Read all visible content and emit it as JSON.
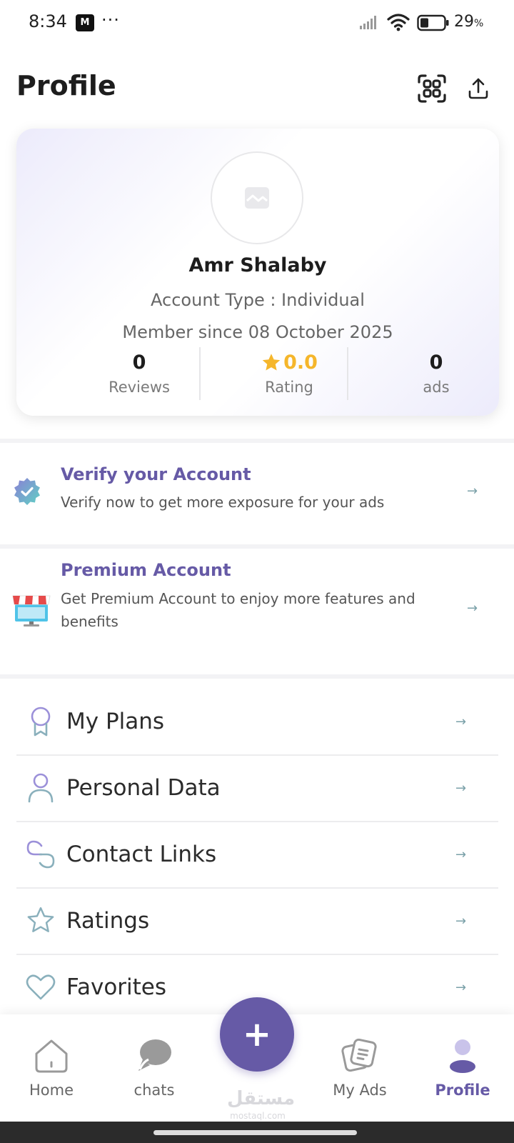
{
  "status_bar": {
    "time": "8:34",
    "app_badge": "M",
    "dots": "···",
    "battery_percent": "29",
    "percent_sign": "%"
  },
  "header": {
    "title": "Profile",
    "icons": [
      "qr-scan-icon",
      "share-icon"
    ]
  },
  "profile": {
    "name": "Amr Shalaby",
    "account_type": "Account Type : Individual",
    "member_since": "Member since 08 October 2025",
    "stats": [
      {
        "value": "0",
        "label": "Reviews"
      },
      {
        "value": "0.0",
        "label": "Rating"
      },
      {
        "value": "0",
        "label": "ads"
      }
    ]
  },
  "promos": [
    {
      "title": "Verify your Account",
      "description": "Verify now to get more exposure for your ads",
      "icon": "verified-badge-icon"
    },
    {
      "title": "Premium Account",
      "description": "Get Premium Account to enjoy more features and benefits",
      "icon": "store-icon"
    }
  ],
  "menu": [
    {
      "label": "My Plans",
      "icon": "award-icon"
    },
    {
      "label": "Personal Data",
      "icon": "user-icon"
    },
    {
      "label": "Contact Links",
      "icon": "link-icon"
    },
    {
      "label": "Ratings",
      "icon": "star-icon"
    },
    {
      "label": "Favorites",
      "icon": "heart-icon"
    }
  ],
  "arrow_glyph": "→",
  "bottom_nav": {
    "items": [
      {
        "label": "Home",
        "icon": "home-icon"
      },
      {
        "label": "chats",
        "icon": "chat-icon"
      },
      {
        "label": "My Ads",
        "icon": "ads-icon"
      },
      {
        "label": "Profile",
        "icon": "profile-icon",
        "active": true
      }
    ],
    "fab_label": "+",
    "fab_icon": "plus-icon"
  },
  "watermark": {
    "text": "مستقل",
    "subtext": "mostaql.com"
  },
  "colors": {
    "accent": "#665aa6",
    "rating": "#f5b62b",
    "arrow": "#7aa0a8",
    "menu_icon_stroke": "#8ab0bc"
  }
}
